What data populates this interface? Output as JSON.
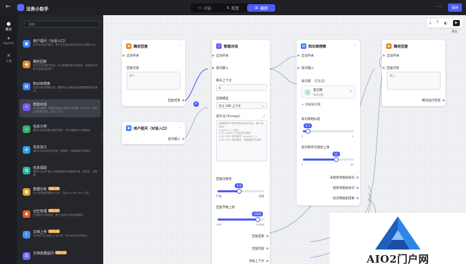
{
  "header": {
    "back_icon": "arrow-left-icon",
    "app_title": "法务小助手",
    "modes": [
      {
        "label": "对话",
        "icon": "chat-icon",
        "active": false
      },
      {
        "label": "配置",
        "icon": "sliders-icon",
        "active": false
      },
      {
        "label": "编排",
        "icon": "flow-icon",
        "active": true
      }
    ],
    "more_label": "···",
    "save_label": "保存"
  },
  "rail": {
    "items": [
      {
        "label": "模块",
        "icon": "cube-icon"
      },
      {
        "label": "Agents",
        "icon": "sparkle-icon"
      },
      {
        "label": "工具",
        "icon": "wrench-icon"
      }
    ]
  },
  "panel": {
    "search_placeholder": "搜索",
    "collapse_icon": "chevron-left-icon",
    "items": [
      {
        "title": "用户提问（对话入口）",
        "desc": "用户在对话中提问，用户在发送后将该节点作为流程入口。",
        "color": "#3f7ef5",
        "icon": "chat-icon",
        "badge": ""
      },
      {
        "title": "确定回复",
        "desc": "该节点在流程中使用，可以根据流程中的变量，将固定的回复内容发送给用户。",
        "color": "#e58a2a",
        "icon": "reply-icon",
        "badge": ""
      },
      {
        "title": "知识库搜索",
        "desc": "在知识库中搜索内容，需要先从大模型检索需要搜索的关键词。",
        "color": "#3f7ef5",
        "icon": "book-icon",
        "badge": ""
      },
      {
        "title": "智能对话",
        "desc": "AI 自动理解，根据内容输入和用户的问题（Prompt）自动生成回复内容，支持上下文。",
        "color": "#7a5cf5",
        "icon": "ai-icon",
        "badge": ""
      },
      {
        "title": "信息分类",
        "desc": "通过AI自动判断问题的类型，可对问题进行分类路由。",
        "color": "#2fb36f",
        "icon": "classify-icon",
        "badge": ""
      },
      {
        "title": "信息加工",
        "desc": "通过AI对信息进行处理，如抽取、归纳和格式化输出。",
        "color": "#2a9ef5",
        "icon": "process-icon",
        "badge": ""
      },
      {
        "title": "信息提取",
        "desc": "通过AI从用户输入中提取结构化的数据字段，如姓名、日期等。",
        "color": "#2fb3a8",
        "icon": "extract-icon",
        "badge": ""
      },
      {
        "title": "数据分析",
        "desc": "可以对表格数据进行分析，支持 csv 和 Excel 文件。",
        "color": "#e5a42a",
        "icon": "chart-icon",
        "badge": "即将上线"
      },
      {
        "title": "记忆管理",
        "desc": "在流程中记录信息，便于后续节点使用和管理。",
        "color": "#e5582a",
        "icon": "memory-icon",
        "badge": "即将上线"
      },
      {
        "title": "文档上传",
        "desc": "允许用户在对话中上传文档，作为后续节点的输入。",
        "color": "#4a8cf5",
        "icon": "upload-icon",
        "badge": "即将上线"
      },
      {
        "title": "文档批量提问",
        "desc": "",
        "color": "#6a6cf5",
        "icon": "batch-icon",
        "badge": "即将上线"
      }
    ]
  },
  "toolbar": {
    "buttons": [
      "download-icon",
      "upload-icon",
      "fit-icon",
      "play-icon"
    ],
    "preview_label": "预览"
  },
  "nodes": {
    "fixed_reply_1": {
      "title": "确定回复",
      "trigger": "启动开关",
      "content_label": "回复内容",
      "content_placeholder": "输入",
      "out": "回复结束"
    },
    "user_question": {
      "title": "用户提问（对话入口）",
      "out": "提问输入"
    },
    "ai_chat": {
      "title": "智能对话",
      "trigger": "启动开关",
      "input": "提问输入",
      "context_label": "聊天上下文",
      "context_value": "6",
      "model_label": "选择模型",
      "model_value": "风工 16K 上下文",
      "prompt_label": "提示词 (Prompt)",
      "prompt_text": "请根据用户提供的相关知识内容，输入信息后：\n{quote} 1. 例如：\n1.对 {quote} 内容进行简述\n2.对 2020 年的事件 {quote} 1.3\n3.对 2020 年的事件，请根据文件资料：",
      "temp_label": "回复创意性",
      "temp_value": "0.9",
      "temp_fraction": 0.45,
      "temp_min": "严谨",
      "temp_max": "发散",
      "tokens_label": "回复字数上限",
      "tokens_value": "2000",
      "tokens_fraction": 0.85,
      "tokens_min": "100",
      "tokens_max": "15000",
      "out_end": "回复结束",
      "out_content": "回复内容",
      "out_append": "添加上下文"
    },
    "kb_search": {
      "title": "知识库搜索",
      "trigger": "启动开关",
      "input": "提问输入",
      "kb_label": "知识库",
      "kb_count": "（可多选）",
      "kb_item_name": "智识库",
      "kb_item_desc": "有效关联",
      "add_label": "添加知识库",
      "sim_label": "知识库相似度",
      "sim_value": "0.1",
      "sim_fraction": 0.1,
      "sim_min": "0",
      "sim_max": "1",
      "limit_label": "知识库单次搜索上限",
      "limit_value": "13",
      "limit_fraction": 0.65,
      "limit_min": "1",
      "limit_max": "20",
      "out_none": "未搜索到相关知识",
      "out_found": "搜索到相关知识",
      "out_result": "知识库搜索结果"
    },
    "fixed_reply_2": {
      "title": "确定回复",
      "trigger": "启动开关",
      "content_label": "回复内容",
      "content_placeholder": "输入",
      "out": "模块运行结束"
    }
  },
  "watermark": {
    "text": "AIO2门户网"
  }
}
